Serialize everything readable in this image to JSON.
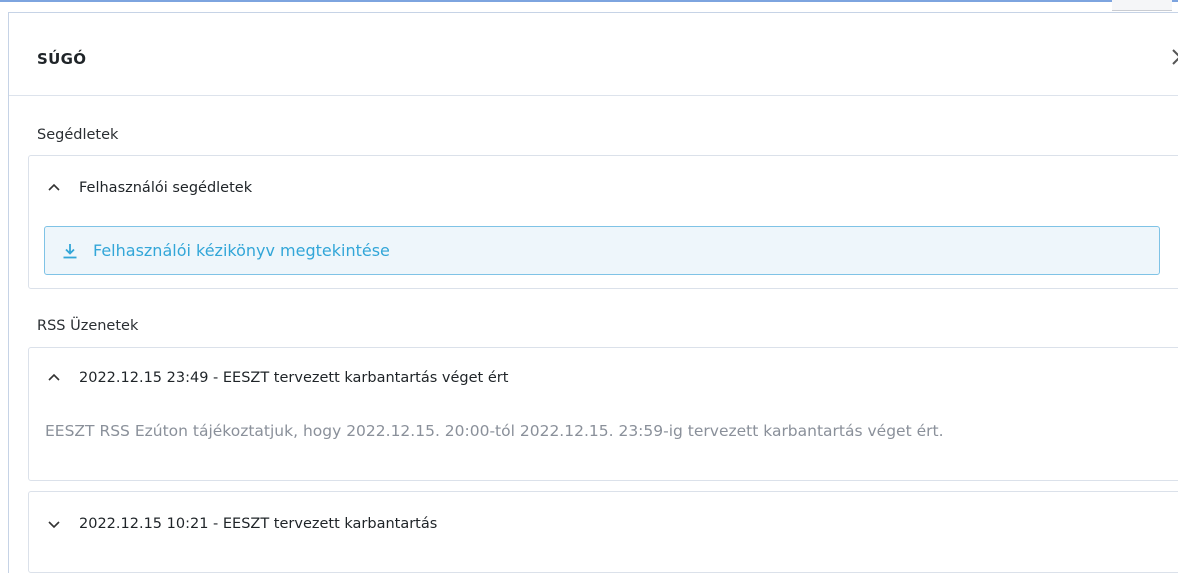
{
  "header": {
    "title": "SÚGÓ",
    "close_icon": "close-icon"
  },
  "guides": {
    "label": "Segédletek",
    "accordion_title": "Felhasználói segédletek",
    "expanded": true,
    "download_label": "Felhasználói kézikönyv megtekintése"
  },
  "rss": {
    "label": "RSS Üzenetek",
    "items": [
      {
        "title": "2022.12.15 23:49 - EESZT tervezett karbantartás véget ért",
        "expanded": true,
        "body": "EESZT RSS Ezúton tájékoztatjuk, hogy 2022.12.15. 20:00-tól 2022.12.15. 23:59-ig tervezett karbantartás véget ért."
      },
      {
        "title": "2022.12.15 10:21 - EESZT tervezett karbantartás",
        "expanded": false
      }
    ]
  },
  "colors": {
    "accent": "#32a6d8",
    "accent_bg": "#eef6fb",
    "border": "#dbe1ea",
    "muted_text": "#8a909a"
  }
}
